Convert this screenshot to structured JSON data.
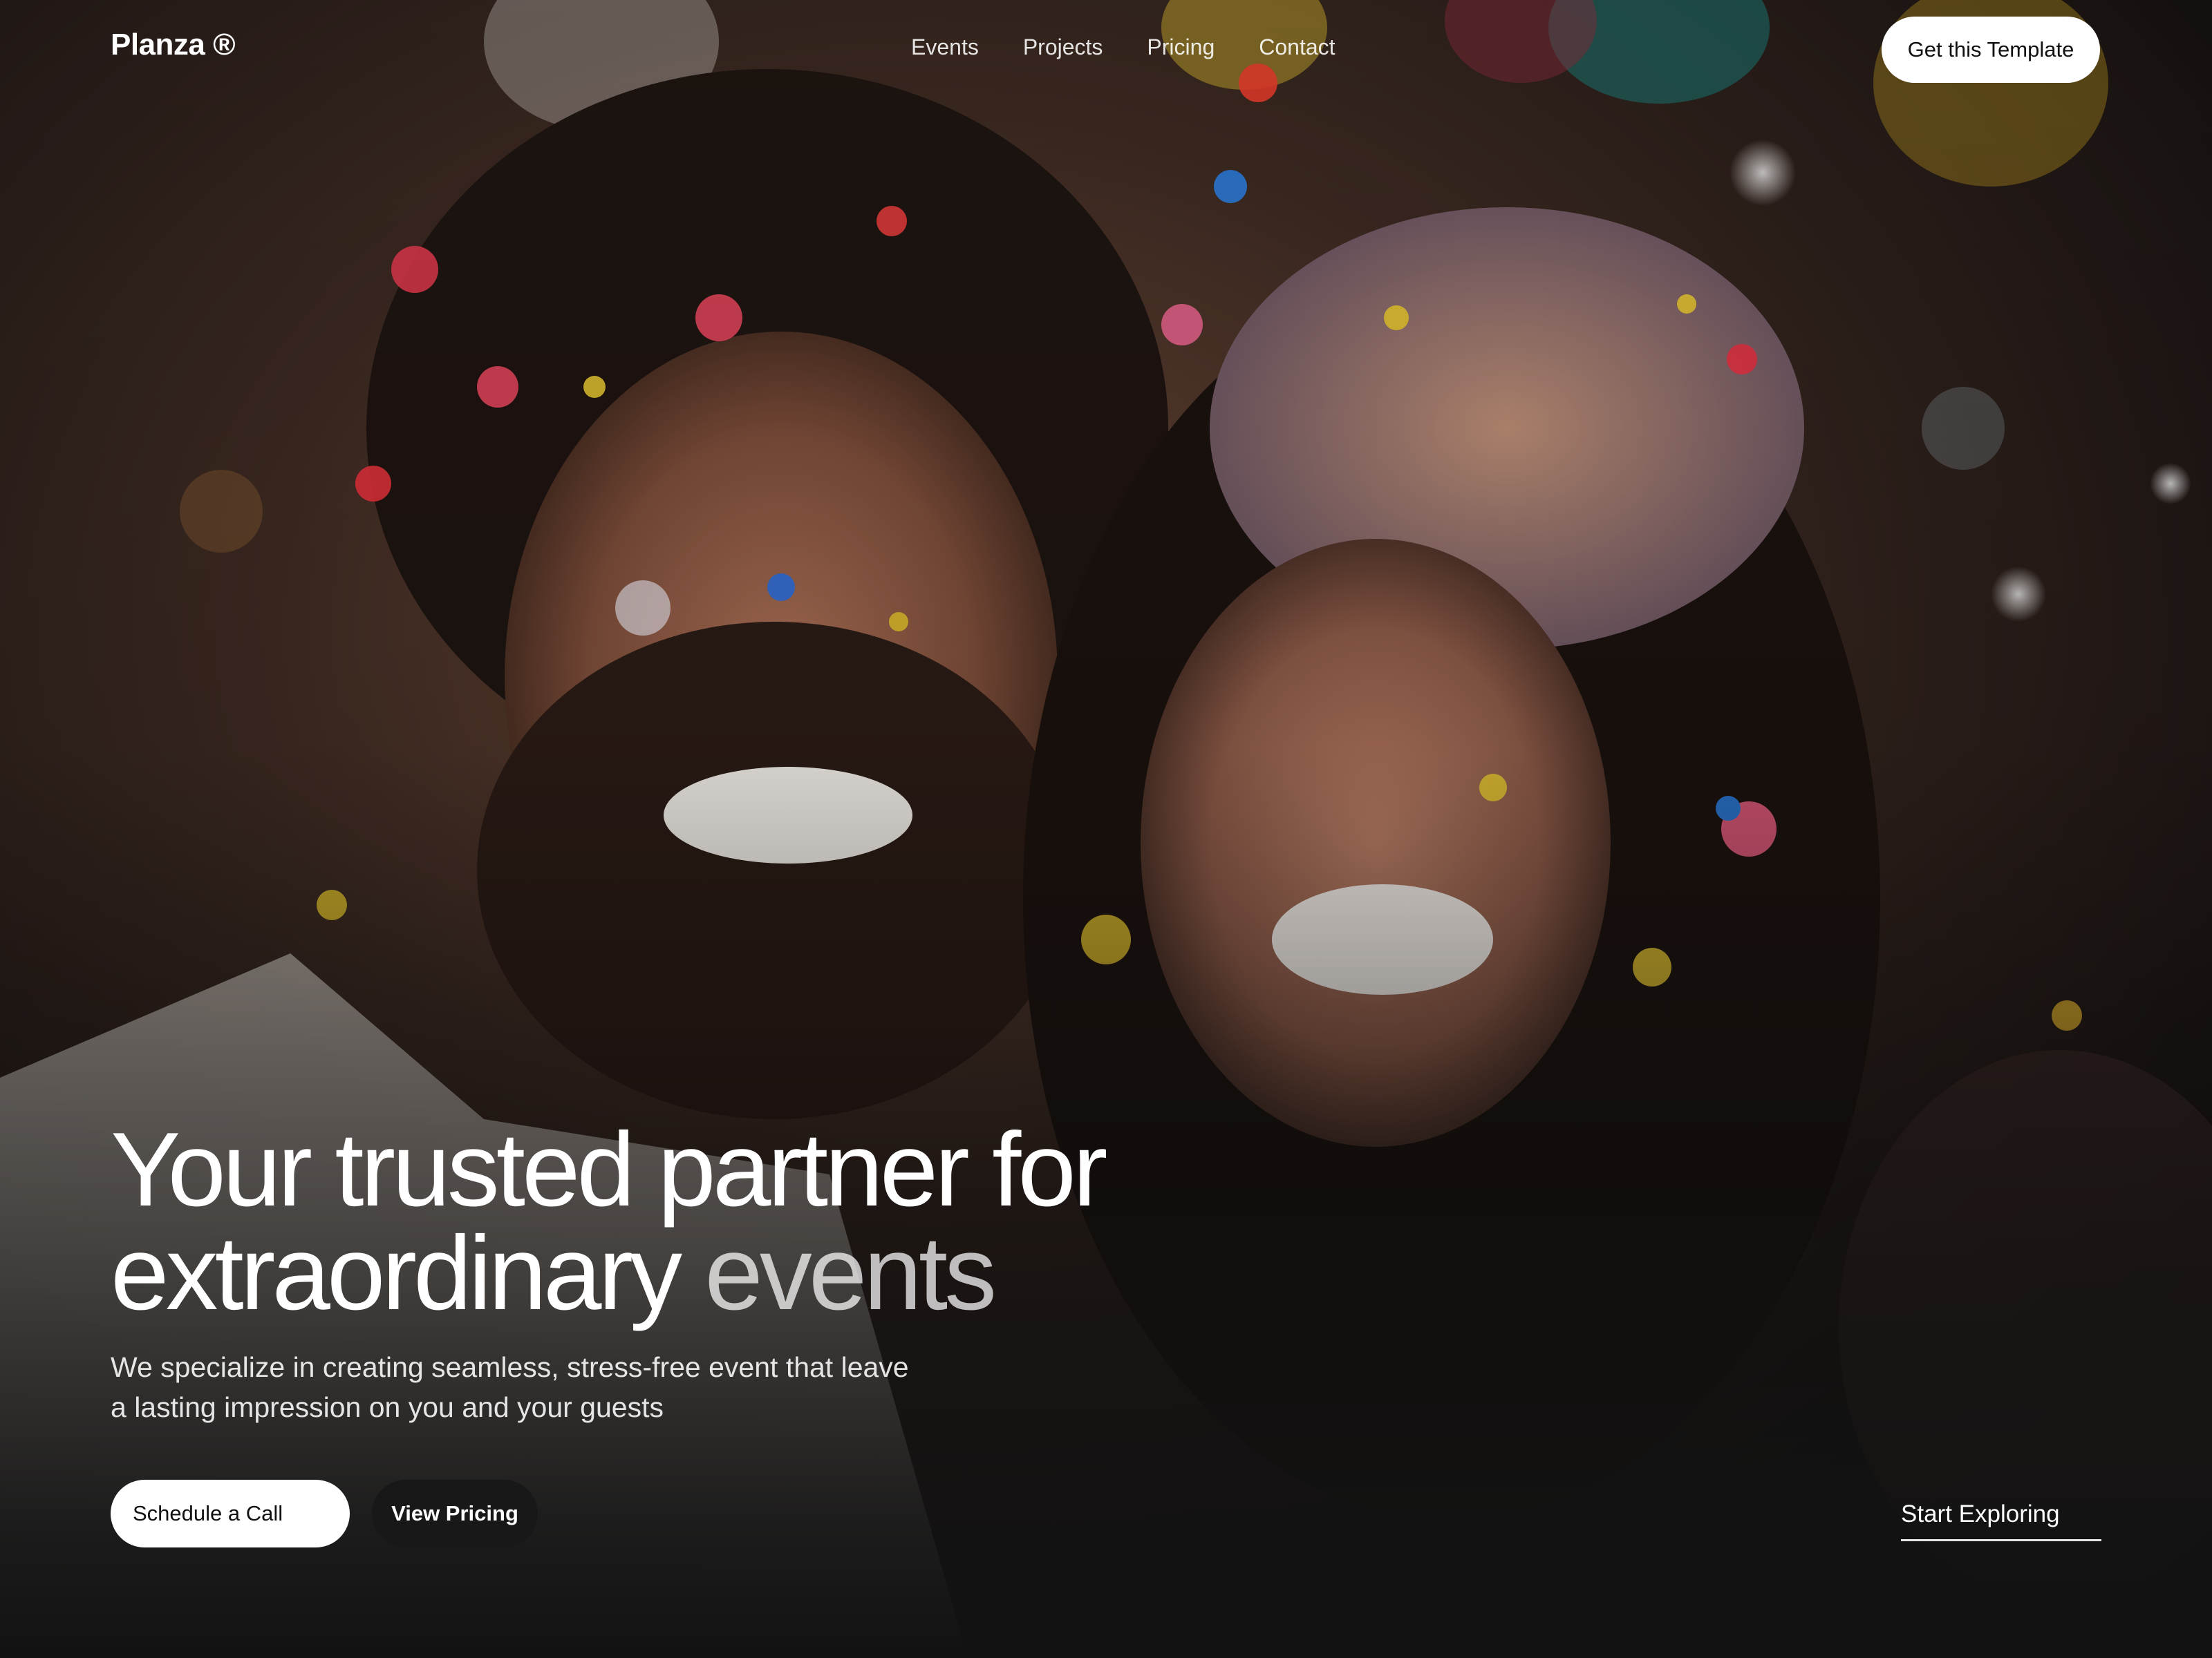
{
  "header": {
    "logo": "Planza ®",
    "nav": [
      "Events",
      "Projects",
      "Pricing",
      "Contact"
    ],
    "cta_label": "Get this Template"
  },
  "hero": {
    "headline_line1": "Your trusted partner for",
    "headline_line2_a": "extraordinary",
    "headline_line2_b": " events",
    "subheadline": "We specialize in creating seamless, stress-free event that leave a lasting impression on you and your guests",
    "primary_button": "Schedule a Call",
    "secondary_button": "View Pricing",
    "explore_link": "Start Exploring",
    "background_image": "photo of a smiling couple at a party with falling confetti"
  },
  "colors": {
    "primary_button_bg": "#ffffff",
    "secondary_button_bg": "#181818",
    "text": "#ffffff"
  }
}
